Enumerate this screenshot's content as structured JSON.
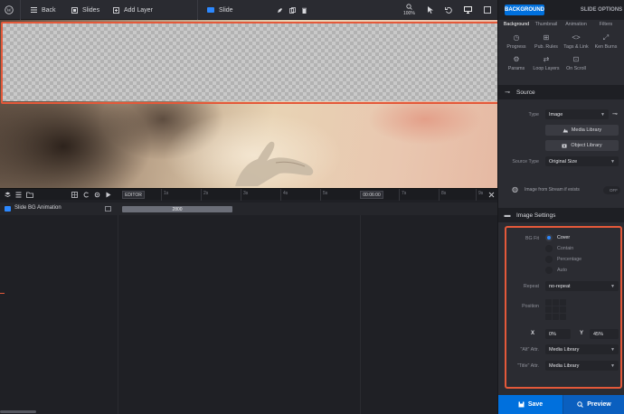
{
  "toolbar": {
    "back_label": "Back",
    "slides_label": "Slides",
    "add_layer_label": "Add Layer",
    "slide_label": "Slide",
    "zoom_label": "100%"
  },
  "timeline": {
    "editor_label": "EDITOR",
    "time_value": "00:06:00",
    "ticks": [
      "1s",
      "2s",
      "3s",
      "4s",
      "5s",
      "7s",
      "8s",
      "9s"
    ],
    "track_label": "Slide BG Animation",
    "track_value": "2800"
  },
  "panel": {
    "tab_background": "BACKGROUND",
    "tab_slide_options": "SLIDE OPTIONS",
    "subtabs": [
      "Background",
      "Thumbnail",
      "Animation",
      "Filters",
      "Progress",
      "Pub. Rules",
      "Tags & Link",
      "Ken Burns",
      "Params",
      "Loop Layers",
      "On Scroll"
    ],
    "source": {
      "title": "Source",
      "type_label": "Type",
      "type_value": "Image",
      "media_library_label": "Media Library",
      "object_library_label": "Object Library",
      "source_type_label": "Source Type",
      "source_type_value": "Original Size",
      "stream_label": "Image from Stream if exists",
      "stream_toggle": "OFF"
    },
    "image_settings": {
      "title": "Image Settings",
      "bg_fit_label": "BG Fit",
      "fit_options": [
        "Cover",
        "Contain",
        "Percentage",
        "Auto"
      ],
      "repeat_label": "Repeat",
      "repeat_value": "no-repeat",
      "position_label": "Position",
      "x_label": "X",
      "x_value": "0%",
      "y_label": "Y",
      "y_value": "45%",
      "alt_label": "\"Alt\" Attr.",
      "alt_value": "Media Library",
      "title_label": "\"Title\" Attr.",
      "title_value": "Media Library"
    },
    "save_label": "Save",
    "preview_label": "Preview"
  },
  "colors": {
    "accent": "#0070dd",
    "highlight": "#e4593a"
  }
}
